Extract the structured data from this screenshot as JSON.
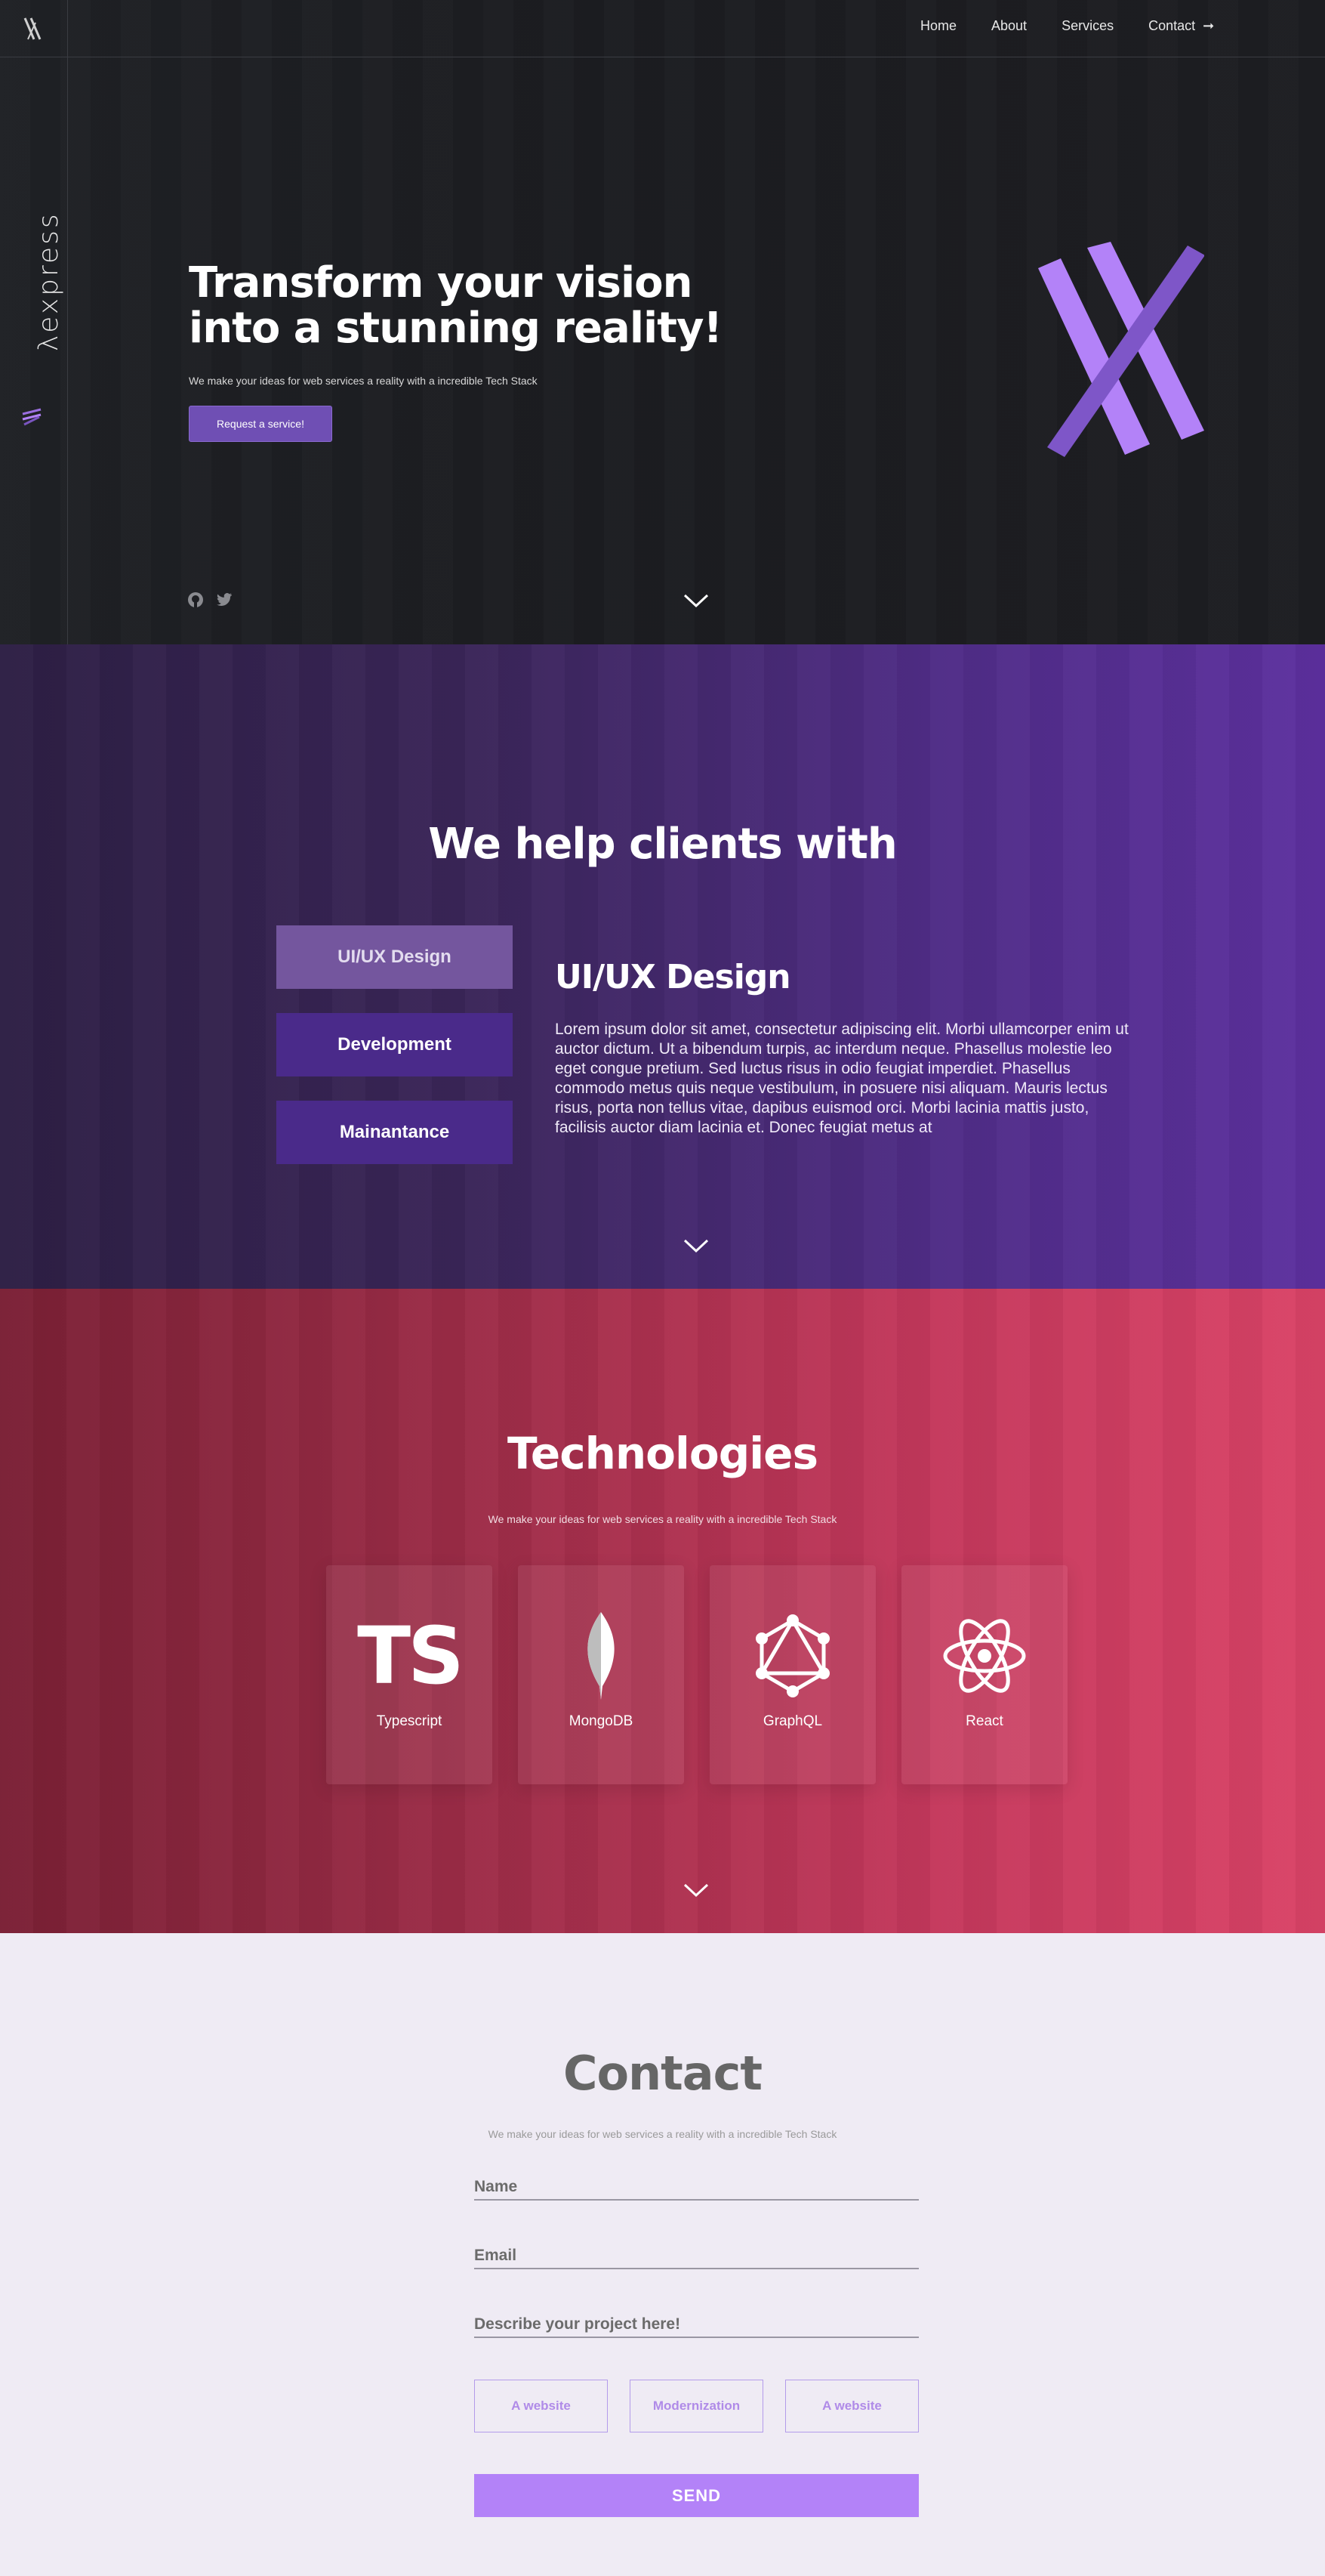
{
  "brand": {
    "name": "λexpress"
  },
  "nav": {
    "items": [
      {
        "label": "Home"
      },
      {
        "label": "About"
      },
      {
        "label": "Services"
      },
      {
        "label": "Contact",
        "arrow": "➞"
      }
    ]
  },
  "hero": {
    "title_line1": "Transform your vision",
    "title_line2": "into a stunning reality!",
    "subtitle": "We make your ideas for web services a reality with a incredible Tech Stack",
    "cta_label": "Request a service!"
  },
  "services": {
    "title": "We help clients with",
    "tabs": [
      {
        "label": "UI/UX Design",
        "active": true
      },
      {
        "label": "Development",
        "active": false
      },
      {
        "label": "Mainantance",
        "active": false
      }
    ],
    "detail_heading": "UI/UX Design",
    "detail_text": "Lorem ipsum dolor sit amet, consectetur adipiscing elit. Morbi ullamcorper enim ut auctor dictum. Ut a bibendum turpis, ac interdum neque. Phasellus molestie leo eget congue pretium. Sed luctus risus in odio feugiat imperdiet. Phasellus commodo metus quis neque vestibulum, in posuere nisi aliquam. Mauris lectus risus, porta non tellus vitae, dapibus euismod orci. Morbi lacinia mattis justo, facilisis auctor diam lacinia et. Donec feugiat metus at"
  },
  "technologies": {
    "title": "Technologies",
    "subtitle": "We make your ideas for web services a reality with a incredible Tech Stack",
    "items": [
      {
        "label": "Typescript",
        "icon": "typescript-icon",
        "glyph": "TS"
      },
      {
        "label": "MongoDB",
        "icon": "mongodb-leaf-icon"
      },
      {
        "label": "GraphQL",
        "icon": "graphql-icon"
      },
      {
        "label": "React",
        "icon": "react-atom-icon"
      }
    ]
  },
  "contact": {
    "title": "Contact",
    "subtitle": "We make your ideas for web services a reality with a incredible Tech Stack",
    "name_placeholder": "Name",
    "email_placeholder": "Email",
    "project_placeholder": "Describe your project here!",
    "options": [
      {
        "label": "A website"
      },
      {
        "label": "Modernization"
      },
      {
        "label": "A website"
      }
    ],
    "send_label": "SEND"
  },
  "colors": {
    "accent_purple": "#b382f8",
    "hero_bg": "#1d1e22",
    "services_bg": "#4f2c86",
    "tech_bg": "#c4385c",
    "contact_bg": "#efebf4"
  }
}
